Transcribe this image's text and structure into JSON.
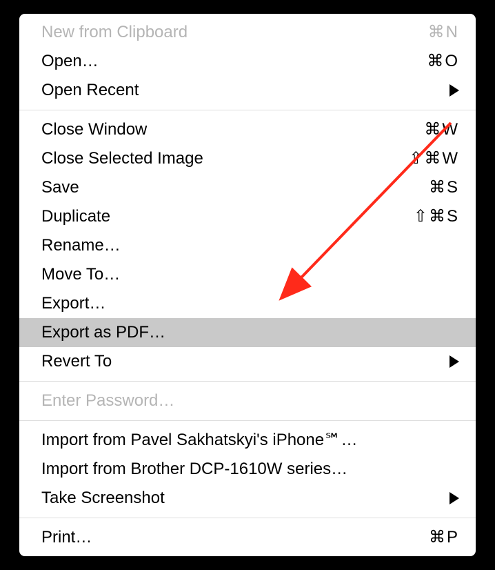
{
  "menu": {
    "sections": [
      [
        {
          "id": "new-from-clipboard",
          "label": "New from Clipboard",
          "shortcut": "⌘N",
          "disabled": true
        },
        {
          "id": "open",
          "label": "Open…",
          "shortcut": "⌘O"
        },
        {
          "id": "open-recent",
          "label": "Open Recent",
          "submenu": true
        }
      ],
      [
        {
          "id": "close-window",
          "label": "Close Window",
          "shortcut": "⌘W"
        },
        {
          "id": "close-selected-image",
          "label": "Close Selected Image",
          "shortcut": "⇧⌘W"
        },
        {
          "id": "save",
          "label": "Save",
          "shortcut": "⌘S"
        },
        {
          "id": "duplicate",
          "label": "Duplicate",
          "shortcut": "⇧⌘S"
        },
        {
          "id": "rename",
          "label": "Rename…"
        },
        {
          "id": "move-to",
          "label": "Move To…"
        },
        {
          "id": "export",
          "label": "Export…"
        },
        {
          "id": "export-as-pdf",
          "label": "Export as PDF…",
          "highlighted": true
        },
        {
          "id": "revert-to",
          "label": "Revert To",
          "submenu": true
        }
      ],
      [
        {
          "id": "enter-password",
          "label": "Enter Password…",
          "disabled": true
        }
      ],
      [
        {
          "id": "import-iphone",
          "label": "Import from Pavel Sakhatskyi's iPhone℠…"
        },
        {
          "id": "import-printer",
          "label": "Import from Brother DCP-1610W series…"
        },
        {
          "id": "take-screenshot",
          "label": "Take Screenshot",
          "submenu": true
        }
      ],
      [
        {
          "id": "print",
          "label": "Print…",
          "shortcut": "⌘P"
        }
      ]
    ]
  },
  "annotation": {
    "type": "arrow",
    "color": "#ff2a1a",
    "target": "export-as-pdf"
  }
}
